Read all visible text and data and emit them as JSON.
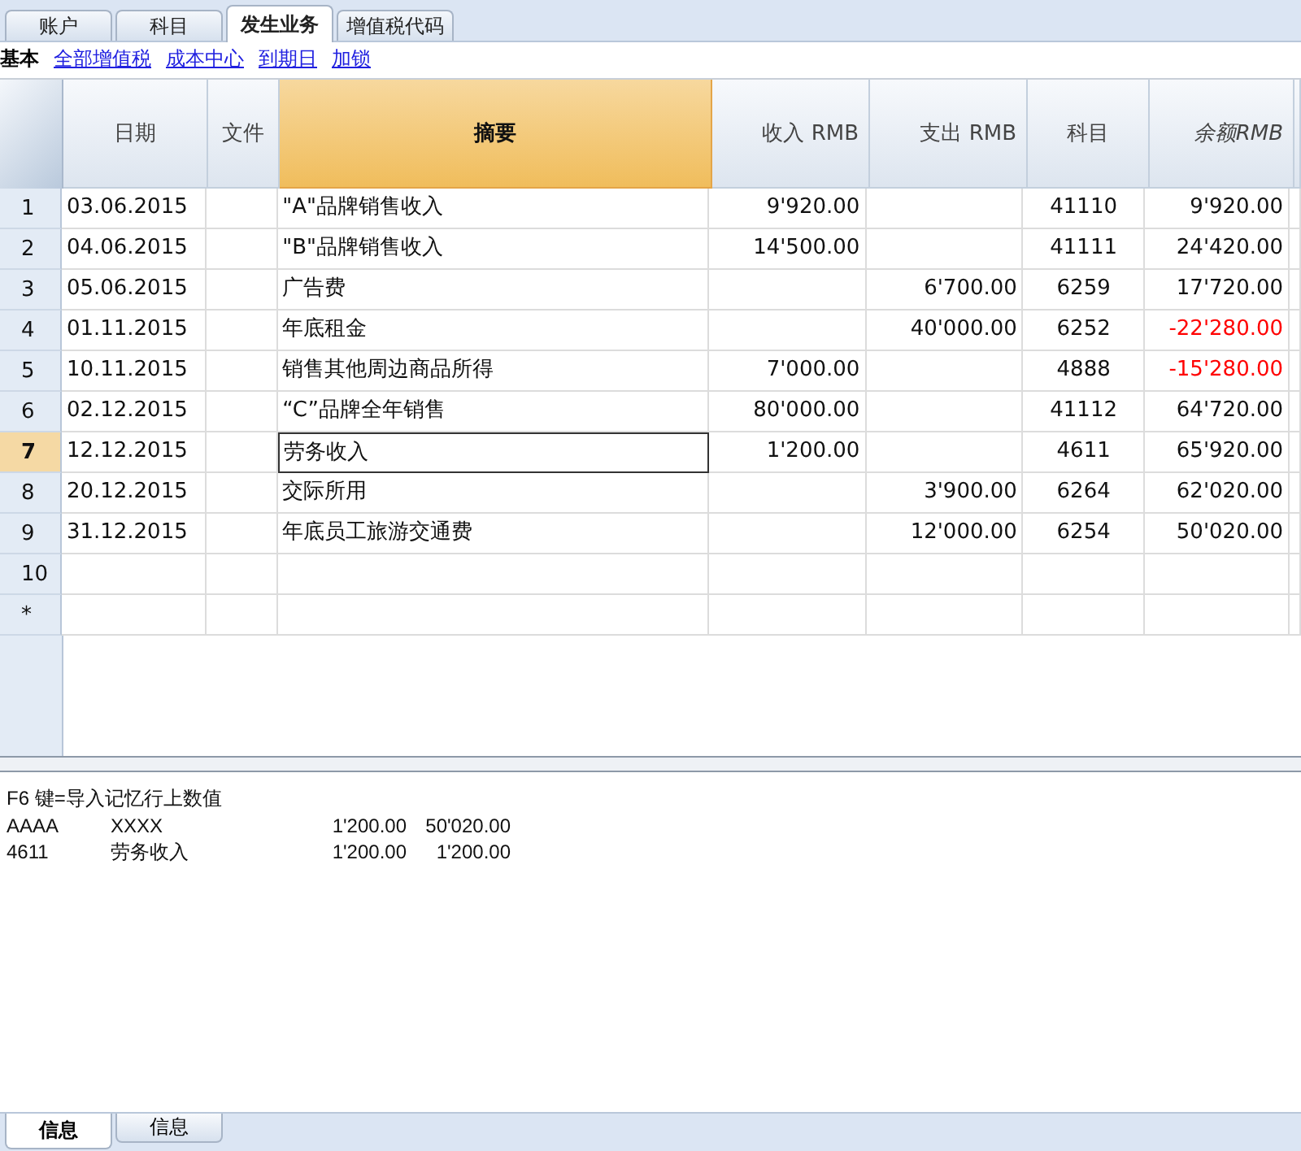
{
  "tabs": [
    {
      "label": "账户",
      "selected": false
    },
    {
      "label": "科目",
      "selected": false
    },
    {
      "label": "发生业务",
      "selected": true
    },
    {
      "label": "增值税代码",
      "selected": false
    }
  ],
  "views": [
    {
      "label": "基本",
      "selected": true
    },
    {
      "label": "全部增值税",
      "selected": false
    },
    {
      "label": "成本中心",
      "selected": false
    },
    {
      "label": "到期日",
      "selected": false
    },
    {
      "label": "加锁",
      "selected": false
    }
  ],
  "table": {
    "columns": [
      {
        "label": "日期",
        "selected": false,
        "italic": false
      },
      {
        "label": "文件",
        "selected": false,
        "italic": false
      },
      {
        "label": "摘要",
        "selected": true,
        "italic": false
      },
      {
        "label": "收入 RMB",
        "selected": false,
        "italic": false
      },
      {
        "label": "支出 RMB",
        "selected": false,
        "italic": false
      },
      {
        "label": "科目",
        "selected": false,
        "italic": false
      },
      {
        "label": "余额RMB",
        "selected": false,
        "italic": true
      }
    ],
    "rows": [
      {
        "num": "1",
        "selected": false,
        "negative": false,
        "cells": [
          "03.06.2015",
          "",
          "\"A\"品牌销售收入",
          "9'920.00",
          "",
          "41110",
          "9'920.00"
        ]
      },
      {
        "num": "2",
        "selected": false,
        "negative": false,
        "cells": [
          "04.06.2015",
          "",
          "\"B\"品牌销售收入",
          "14'500.00",
          "",
          "41111",
          "24'420.00"
        ]
      },
      {
        "num": "3",
        "selected": false,
        "negative": false,
        "cells": [
          "05.06.2015",
          "",
          "广告费",
          "",
          "6'700.00",
          "6259",
          "17'720.00"
        ]
      },
      {
        "num": "4",
        "selected": false,
        "negative": true,
        "cells": [
          "01.11.2015",
          "",
          "年底租金",
          "",
          "40'000.00",
          "6252",
          "-22'280.00"
        ]
      },
      {
        "num": "5",
        "selected": false,
        "negative": true,
        "cells": [
          "10.11.2015",
          "",
          "销售其他周边商品所得",
          "7'000.00",
          "",
          "4888",
          "-15'280.00"
        ]
      },
      {
        "num": "6",
        "selected": false,
        "negative": false,
        "cells": [
          "02.12.2015",
          "",
          "“C”品牌全年销售",
          "80'000.00",
          "",
          "41112",
          "64'720.00"
        ]
      },
      {
        "num": "7",
        "selected": true,
        "negative": false,
        "cells": [
          "12.12.2015",
          "",
          "劳务收入",
          "1'200.00",
          "",
          "4611",
          "65'920.00"
        ]
      },
      {
        "num": "8",
        "selected": false,
        "negative": false,
        "cells": [
          "20.12.2015",
          "",
          "交际所用",
          "",
          "3'900.00",
          "6264",
          "62'020.00"
        ]
      },
      {
        "num": "9",
        "selected": false,
        "negative": false,
        "cells": [
          "31.12.2015",
          "",
          "年底员工旅游交通费",
          "",
          "12'000.00",
          "6254",
          "50'020.00"
        ]
      },
      {
        "num": "10",
        "selected": false,
        "cells": [
          "",
          "",
          "",
          "",
          "",
          "",
          ""
        ]
      },
      {
        "num": "*",
        "selected": false,
        "cells": [
          "",
          "",
          "",
          "",
          "",
          "",
          ""
        ]
      }
    ]
  },
  "info": {
    "hint": "F6 键=导入记忆行上数值",
    "lines": [
      [
        "AAAA",
        "XXXX",
        "1'200.00",
        "50'020.00"
      ],
      [
        "4611",
        "劳务收入",
        "1'200.00",
        "1'200.00"
      ]
    ]
  },
  "bottom_tabs": [
    {
      "label": "信息",
      "selected": true
    },
    {
      "label": "信息",
      "selected": false
    }
  ]
}
